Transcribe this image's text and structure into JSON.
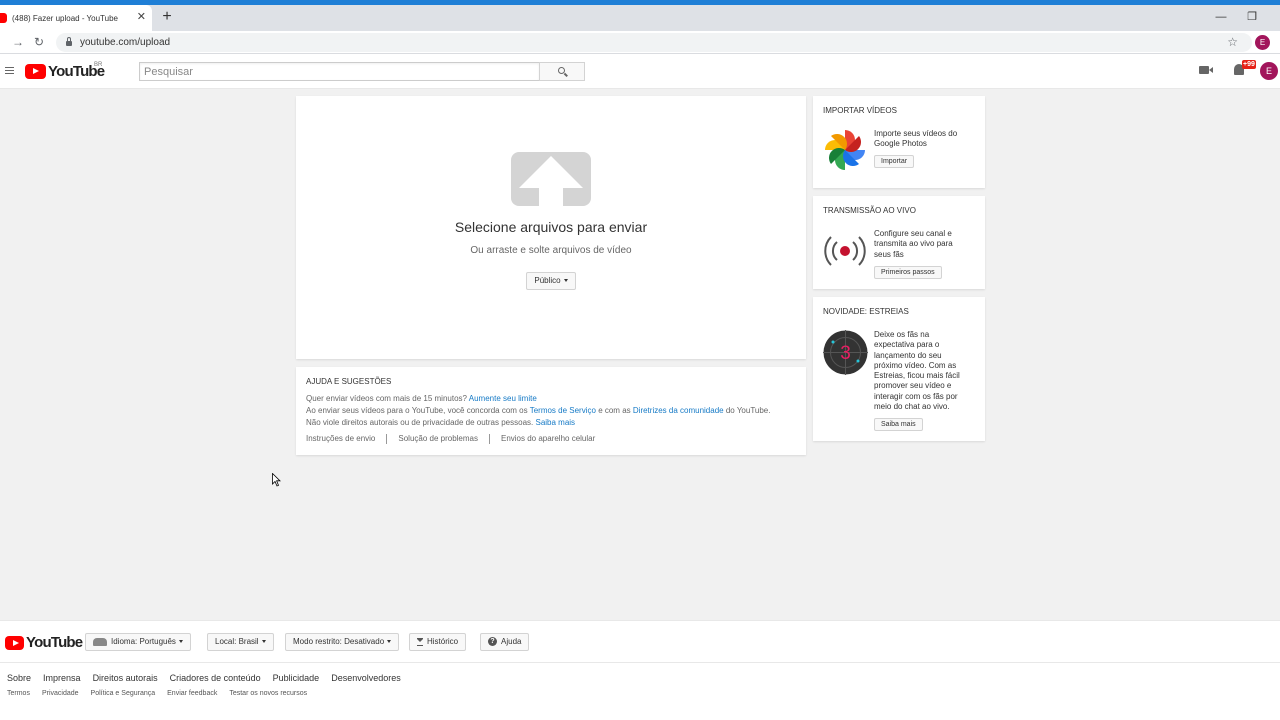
{
  "browser": {
    "tab_title": "(488) Fazer upload - YouTube",
    "tab_close": "✕",
    "new_tab": "+",
    "url": "youtube.com/upload",
    "profile_initial": "E",
    "minimize": "—",
    "restore": "❐"
  },
  "header": {
    "logo_text": "YouTube",
    "region": "BR",
    "search_placeholder": "Pesquisar",
    "notification_count": "+99",
    "avatar_initial": "E"
  },
  "upload": {
    "title": "Selecione arquivos para enviar",
    "subtitle": "Ou arraste e solte arquivos de vídeo",
    "privacy": "Público"
  },
  "help": {
    "title": "AJUDA E SUGESTÕES",
    "line1_text": "Quer enviar vídeos com mais de 15 minutos?",
    "line1_link": "Aumente seu limite",
    "line2_a": "Ao enviar seus vídeos para o YouTube, você concorda com os",
    "line2_link1": "Termos de Serviço",
    "line2_b": "e com as",
    "line2_link2": "Diretrizes da comunidade",
    "line2_c": "do YouTube.",
    "line3_text": "Não viole direitos autorais ou de privacidade de outras pessoas.",
    "line3_link": "Saiba mais",
    "links": [
      "Instruções de envio",
      "Solução de problemas",
      "Envios do aparelho celular"
    ]
  },
  "sidebar": {
    "import": {
      "title": "IMPORTAR VÍDEOS",
      "text": "Importe seus vídeos do Google Photos",
      "button": "Importar"
    },
    "live": {
      "title": "TRANSMISSÃO AO VIVO",
      "text": "Configure seu canal e transmita ao vivo para seus fãs",
      "button": "Primeiros passos"
    },
    "premiere": {
      "title": "NOVIDADE: ESTREIAS",
      "text": "Deixe os fãs na expectativa para o lançamento do seu próximo vídeo. Com as Estreias, ficou mais fácil promover seu vídeo e interagir com os fãs por meio do chat ao vivo.",
      "button": "Saiba mais",
      "countdown": "3"
    }
  },
  "footer": {
    "logo_text": "YouTube",
    "language": "Idioma: Português",
    "location": "Local: Brasil",
    "restricted": "Modo restrito: Desativado",
    "history": "Histórico",
    "help": "Ajuda",
    "links_primary": [
      "Sobre",
      "Imprensa",
      "Direitos autorais",
      "Criadores de conteúdo",
      "Publicidade",
      "Desenvolvedores"
    ],
    "links_secondary": [
      "Termos",
      "Privacidade",
      "Política e Segurança",
      "Enviar feedback",
      "Testar os novos recursos"
    ]
  },
  "colors": {
    "brand_red": "#ff0000",
    "link_blue": "#167ac6",
    "avatar": "#a2155b",
    "browser_accent": "#1f7fd6"
  }
}
